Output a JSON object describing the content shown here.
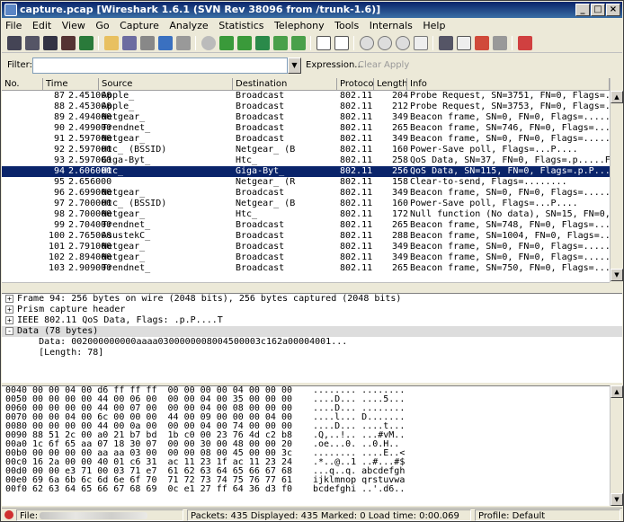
{
  "window": {
    "title": "capture.pcap  [Wireshark 1.6.1  (SVN Rev 38096 from /trunk-1.6)]"
  },
  "menu": [
    "File",
    "Edit",
    "View",
    "Go",
    "Capture",
    "Analyze",
    "Statistics",
    "Telephony",
    "Tools",
    "Internals",
    "Help"
  ],
  "toolbar_icons": [
    "interface-list-icon",
    "capture-options-icon",
    "start-capture-icon",
    "stop-capture-icon",
    "restart-capture-icon",
    "open-file-icon",
    "save-file-icon",
    "close-file-icon",
    "reload-icon",
    "print-icon",
    "find-packet-icon",
    "back-icon",
    "forward-icon",
    "go-to-packet-icon",
    "first-packet-icon",
    "last-packet-icon",
    "colorize-icon",
    "autoscroll-icon",
    "zoom-in-icon",
    "zoom-out-icon",
    "normal-size-icon",
    "resize-columns-icon",
    "capture-filters-icon",
    "display-filters-icon",
    "coloring-rules-icon",
    "preferences-icon",
    "help-icon"
  ],
  "filter": {
    "label": "Filter:",
    "value": "",
    "expression": "Expression...",
    "clear": "Clear",
    "apply": "Apply"
  },
  "columns": [
    "No.",
    "Time",
    "Source",
    "Destination",
    "Protocol",
    "Length",
    "Info"
  ],
  "packets": [
    {
      "no": "87",
      "time": "2.451000",
      "src": "Apple_",
      "dst": "Broadcast",
      "proto": "802.11",
      "len": "204",
      "info": "Probe Request, SN=3751, FN=0, Flags=..."
    },
    {
      "no": "88",
      "time": "2.453000",
      "src": "Apple_",
      "dst": "Broadcast",
      "proto": "802.11",
      "len": "212",
      "info": "Probe Request, SN=3753, FN=0, Flags=..."
    },
    {
      "no": "89",
      "time": "2.494000",
      "src": "Netgear_",
      "dst": "Broadcast",
      "proto": "802.11",
      "len": "349",
      "info": "Beacon frame, SN=0, FN=0, Flags=....."
    },
    {
      "no": "90",
      "time": "2.499000",
      "src": "Trendnet_",
      "dst": "Broadcast",
      "proto": "802.11",
      "len": "265",
      "info": "Beacon frame, SN=746, FN=0, Flags=...."
    },
    {
      "no": "91",
      "time": "2.597000",
      "src": "Netgear_",
      "dst": "Broadcast",
      "proto": "802.11",
      "len": "349",
      "info": "Beacon frame, SN=0, FN=0, Flags=....."
    },
    {
      "no": "92",
      "time": "2.597000",
      "src": "Htc_            (BSSID)",
      "dst": "Netgear_              (B",
      "proto": "802.11",
      "len": "160",
      "info": "Power-Save poll, Flags=...P...."
    },
    {
      "no": "93",
      "time": "2.597000",
      "src": "Giga-Byt_",
      "dst": "Htc_",
      "proto": "802.11",
      "len": "258",
      "info": "QoS Data, SN=37, FN=0, Flags=.p.....F"
    },
    {
      "no": "94",
      "time": "2.606000",
      "src": "Htc_",
      "dst": "Giga-Byt_",
      "proto": "802.11",
      "len": "256",
      "info": "QoS Data, SN=115, FN=0, Flags=.p.P....T"
    },
    {
      "no": "95",
      "time": "2.656000",
      "src": "",
      "dst": "Netgear_              (R",
      "proto": "802.11",
      "len": "158",
      "info": "Clear-to-send, Flags=........"
    },
    {
      "no": "96",
      "time": "2.699000",
      "src": "Netgear_",
      "dst": "Broadcast",
      "proto": "802.11",
      "len": "349",
      "info": "Beacon frame, SN=0, FN=0, Flags=....."
    },
    {
      "no": "97",
      "time": "2.700000",
      "src": "Htc_            (BSSID)",
      "dst": "Netgear_              (B",
      "proto": "802.11",
      "len": "160",
      "info": "Power-Save poll, Flags=...P...."
    },
    {
      "no": "98",
      "time": "2.700000",
      "src": "Netgear_",
      "dst": "Htc_",
      "proto": "802.11",
      "len": "172",
      "info": "Null function (No data), SN=15, FN=0,"
    },
    {
      "no": "99",
      "time": "2.704000",
      "src": "Trendnet_",
      "dst": "Broadcast",
      "proto": "802.11",
      "len": "265",
      "info": "Beacon frame, SN=748, FN=0, Flags=...."
    },
    {
      "no": "100",
      "time": "2.765000",
      "src": "AsustekC_",
      "dst": "Broadcast",
      "proto": "802.11",
      "len": "288",
      "info": "Beacon frame, SN=1004, FN=0, Flags=..."
    },
    {
      "no": "101",
      "time": "2.791000",
      "src": "Netgear_",
      "dst": "Broadcast",
      "proto": "802.11",
      "len": "349",
      "info": "Beacon frame, SN=0, FN=0, Flags=....."
    },
    {
      "no": "102",
      "time": "2.894000",
      "src": "Netgear_",
      "dst": "Broadcast",
      "proto": "802.11",
      "len": "349",
      "info": "Beacon frame, SN=0, FN=0, Flags=....."
    },
    {
      "no": "103",
      "time": "2.909000",
      "src": "Trendnet_",
      "dst": "Broadcast",
      "proto": "802.11",
      "len": "265",
      "info": "Beacon frame, SN=750, FN=0, Flags=...."
    }
  ],
  "selected_packet_index": 7,
  "details": [
    {
      "sign": "+",
      "text": "Frame 94: 256 bytes on wire (2048 bits), 256 bytes captured (2048 bits)"
    },
    {
      "sign": "+",
      "text": "Prism capture header"
    },
    {
      "sign": "+",
      "text": "IEEE 802.11 QoS Data, Flags: .p.P....T"
    },
    {
      "sign": "-",
      "text": "Data (78 bytes)"
    },
    {
      "sign": "",
      "text": "    Data: 002000000000aaaa0300000008004500003c162a00004001..."
    },
    {
      "sign": "",
      "text": "    [Length: 78]"
    }
  ],
  "bytes": [
    {
      "off": "0040",
      "hex": "00 00 04 00 d6 ff ff ff  00 00 00 00 04 00 00 00",
      "asc": "........ ........"
    },
    {
      "off": "0050",
      "hex": "00 00 00 00 44 00 06 00  00 00 04 00 35 00 00 00",
      "asc": "....D... ....5..."
    },
    {
      "off": "0060",
      "hex": "00 00 00 00 44 00 07 00  00 00 04 00 08 00 00 00",
      "asc": "....D... ........"
    },
    {
      "off": "0070",
      "hex": "00 00 04 00 6c 00 00 00  44 00 09 00 00 00 04 00",
      "asc": "....l... D......."
    },
    {
      "off": "0080",
      "hex": "00 00 00 00 44 00 0a 00  00 00 04 00 74 00 00 00",
      "asc": "....D... ....t..."
    },
    {
      "off": "0090",
      "hex": "88 51 2c 00 a0 21 b7 bd  1b c0 00 23 76 4d c2 b8",
      "asc": ".Q,..!.. ...#vM.."
    },
    {
      "off": "00a0",
      "hex": "1c 6f 65 aa 07 18 30 07  00 00 30 00 48 00 00 20",
      "asc": ".oe...0. ..0.H.. "
    },
    {
      "off": "00b0",
      "hex": "00 00 00 00 aa aa 03 00  00 00 08 00 45 00 00 3c",
      "asc": "........ ....E..<"
    },
    {
      "off": "00c0",
      "hex": "16 2a 00 00 40 01 c6 31  ac 11 23 1f ac 11 23 24",
      "asc": ".*..@..1 ..#...#$"
    },
    {
      "off": "00d0",
      "hex": "00 00 e3 71 00 03 71 e7  61 62 63 64 65 66 67 68",
      "asc": "...q..q. abcdefgh"
    },
    {
      "off": "00e0",
      "hex": "69 6a 6b 6c 6d 6e 6f 70  71 72 73 74 75 76 77 61",
      "asc": "ijklmnop qrstuvwa"
    },
    {
      "off": "00f0",
      "hex": "62 63 64 65 66 67 68 69  0c e1 27 ff 64 36 d3 f0",
      "asc": "bcdefghi ..'.d6.."
    }
  ],
  "status": {
    "file": "File:",
    "packets": "Packets: 435 Displayed: 435 Marked: 0 Load time: 0:00.069",
    "profile": "Profile: Default"
  }
}
